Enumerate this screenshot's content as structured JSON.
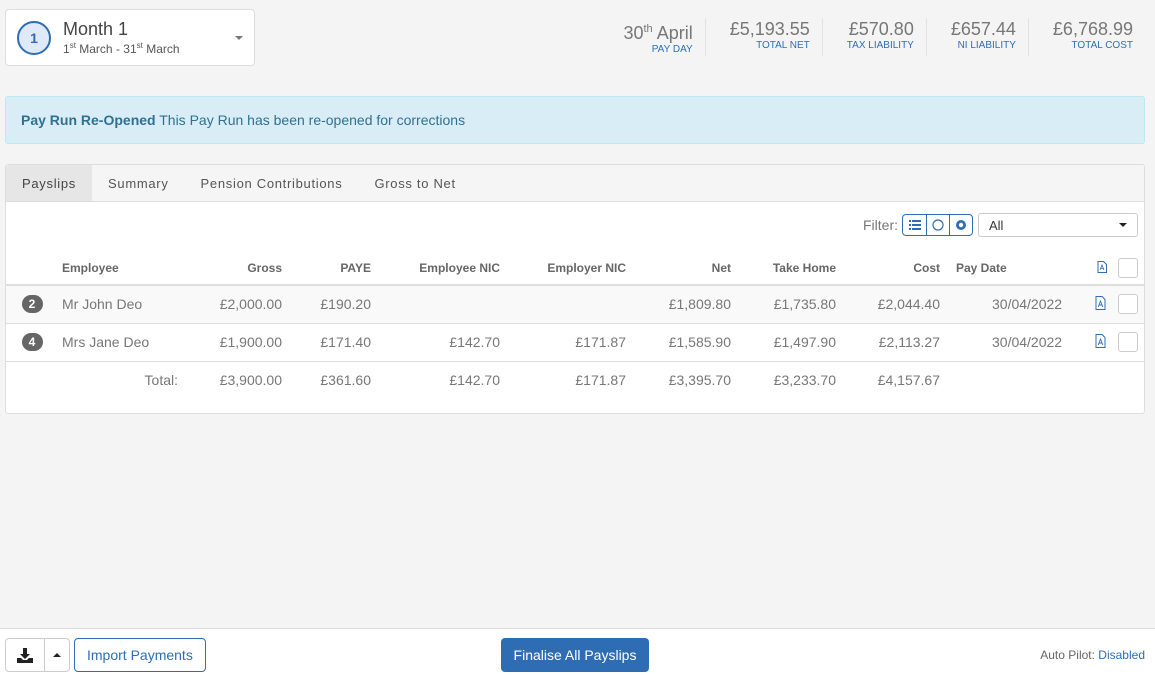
{
  "period": {
    "step": "1",
    "title": "Month 1",
    "range_start_day": "1",
    "range_start_suffix": "st",
    "range_start_month": "March",
    "range_sep": "-",
    "range_end_day": "31",
    "range_end_suffix": "st",
    "range_end_month": "March"
  },
  "stats": [
    {
      "value_day": "30",
      "value_suffix": "th",
      "value_month": "April",
      "label": "PAY DAY"
    },
    {
      "value": "£5,193.55",
      "label": "TOTAL NET"
    },
    {
      "value": "£570.80",
      "label": "TAX LIABILITY"
    },
    {
      "value": "£657.44",
      "label": "NI LIABILITY"
    },
    {
      "value": "£6,768.99",
      "label": "TOTAL COST"
    }
  ],
  "alert": {
    "title": "Pay Run Re-Opened",
    "message": "This Pay Run has been re-opened for corrections"
  },
  "tabs": [
    {
      "label": "Payslips",
      "active": true
    },
    {
      "label": "Summary"
    },
    {
      "label": "Pension Contributions"
    },
    {
      "label": "Gross to Net"
    }
  ],
  "filter": {
    "label": "Filter:",
    "toggle_icons": [
      "list-icon",
      "circle-outline-icon",
      "circle-dot-icon"
    ],
    "selected": "All"
  },
  "table": {
    "columns": [
      "Employee",
      "Gross",
      "PAYE",
      "Employee NIC",
      "Employer NIC",
      "Net",
      "Take Home",
      "Cost",
      "Pay Date"
    ],
    "rows": [
      {
        "badge": "2",
        "employee": "Mr John Deo",
        "gross": "£2,000.00",
        "paye": "£190.20",
        "employee_nic": "",
        "employer_nic": "",
        "net": "£1,809.80",
        "take_home": "£1,735.80",
        "cost": "£2,044.40",
        "pay_date": "30/04/2022"
      },
      {
        "badge": "4",
        "employee": "Mrs Jane Deo",
        "gross": "£1,900.00",
        "paye": "£171.40",
        "employee_nic": "£142.70",
        "employer_nic": "£171.87",
        "net": "£1,585.90",
        "take_home": "£1,497.90",
        "cost": "£2,113.27",
        "pay_date": "30/04/2022"
      }
    ],
    "total": {
      "label": "Total:",
      "gross": "£3,900.00",
      "paye": "£361.60",
      "employee_nic": "£142.70",
      "employer_nic": "£171.87",
      "net": "£3,395.70",
      "take_home": "£3,233.70",
      "cost": "£4,157.67"
    }
  },
  "footer": {
    "import_label": "Import Payments",
    "finalise_label": "Finalise All Payslips",
    "autopilot_label": "Auto Pilot:",
    "autopilot_value": "Disabled"
  },
  "colors": {
    "accent": "#2e6db4",
    "alert_bg": "#d9edf7",
    "alert_text": "#31708f"
  }
}
